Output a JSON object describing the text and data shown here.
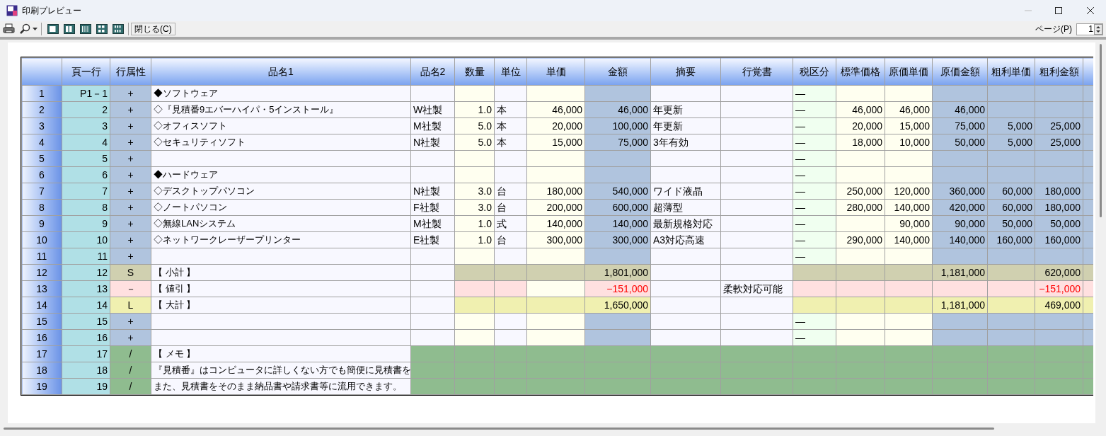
{
  "window": {
    "title": "印刷プレビュー"
  },
  "toolbar": {
    "close_button": "閉じる(C)",
    "page_label": "ページ(P)",
    "page_value": "1"
  },
  "table": {
    "columns": [
      {
        "label": "頁一行"
      },
      {
        "label": "行属性"
      },
      {
        "label": "品名1"
      },
      {
        "label": "品名2"
      },
      {
        "label": "数量"
      },
      {
        "label": "単位"
      },
      {
        "label": "単価"
      },
      {
        "label": "金額"
      },
      {
        "label": "摘要"
      },
      {
        "label": "行覚書"
      },
      {
        "label": "税区分"
      },
      {
        "label": "標準価格"
      },
      {
        "label": "原価単価"
      },
      {
        "label": "原価金額"
      },
      {
        "label": "粗利単価"
      },
      {
        "label": "粗利金額"
      }
    ],
    "rows": [
      {
        "kind": "item",
        "no": "1",
        "page_line": "P1－1",
        "attr": "+",
        "name1": "◆ソフトウェア",
        "tax": "—"
      },
      {
        "kind": "item",
        "no": "2",
        "page_line": "2",
        "attr": "+",
        "name1": "◇『見積番9エバーハイパ・5インストール』",
        "name2": "W社製",
        "qty": "1.0",
        "unit": "本",
        "price": "46,000",
        "amount": "46,000",
        "summary": "年更新",
        "tax": "—",
        "std_price": "46,000",
        "cost_unit": "46,000",
        "cost_amount": "46,000"
      },
      {
        "kind": "item",
        "no": "3",
        "page_line": "3",
        "attr": "+",
        "name1": "◇オフィスソフト",
        "name2": "M社製",
        "qty": "5.0",
        "unit": "本",
        "price": "20,000",
        "amount": "100,000",
        "summary": "年更新",
        "tax": "—",
        "std_price": "20,000",
        "cost_unit": "15,000",
        "cost_amount": "75,000",
        "gp_unit": "5,000",
        "gp_amount": "25,000"
      },
      {
        "kind": "item",
        "no": "4",
        "page_line": "4",
        "attr": "+",
        "name1": "◇セキュリティソフト",
        "name2": "N社製",
        "qty": "5.0",
        "unit": "本",
        "price": "15,000",
        "amount": "75,000",
        "summary": "3年有効",
        "tax": "—",
        "std_price": "18,000",
        "cost_unit": "10,000",
        "cost_amount": "50,000",
        "gp_unit": "5,000",
        "gp_amount": "25,000"
      },
      {
        "kind": "item",
        "no": "5",
        "page_line": "5",
        "attr": "+",
        "tax": "—"
      },
      {
        "kind": "item",
        "no": "6",
        "page_line": "6",
        "attr": "+",
        "name1": "◆ハードウェア",
        "tax": "—"
      },
      {
        "kind": "item",
        "no": "7",
        "page_line": "7",
        "attr": "+",
        "name1": "◇デスクトップパソコン",
        "name2": "N社製",
        "qty": "3.0",
        "unit": "台",
        "price": "180,000",
        "amount": "540,000",
        "summary": "ワイド液晶",
        "tax": "—",
        "std_price": "250,000",
        "cost_unit": "120,000",
        "cost_amount": "360,000",
        "gp_unit": "60,000",
        "gp_amount": "180,000"
      },
      {
        "kind": "item",
        "no": "8",
        "page_line": "8",
        "attr": "+",
        "name1": "◇ノートパソコン",
        "name2": "F社製",
        "qty": "3.0",
        "unit": "台",
        "price": "200,000",
        "amount": "600,000",
        "summary": "超薄型",
        "tax": "—",
        "std_price": "280,000",
        "cost_unit": "140,000",
        "cost_amount": "420,000",
        "gp_unit": "60,000",
        "gp_amount": "180,000"
      },
      {
        "kind": "item",
        "no": "9",
        "page_line": "9",
        "attr": "+",
        "name1": "◇無線LANシステム",
        "name2": "M社製",
        "qty": "1.0",
        "unit": "式",
        "price": "140,000",
        "amount": "140,000",
        "summary": "最新規格対応",
        "tax": "—",
        "cost_unit": "90,000",
        "cost_amount": "90,000",
        "gp_unit": "50,000",
        "gp_amount": "50,000"
      },
      {
        "kind": "item",
        "no": "10",
        "page_line": "10",
        "attr": "+",
        "name1": "◇ネットワークレーザープリンター",
        "name2": "E社製",
        "qty": "1.0",
        "unit": "台",
        "price": "300,000",
        "amount": "300,000",
        "summary": "A3対応高速",
        "tax": "—",
        "std_price": "290,000",
        "cost_unit": "140,000",
        "cost_amount": "140,000",
        "gp_unit": "160,000",
        "gp_amount": "160,000"
      },
      {
        "kind": "item",
        "no": "11",
        "page_line": "11",
        "attr": "+",
        "tax": "—"
      },
      {
        "kind": "subtotal",
        "no": "12",
        "page_line": "12",
        "attr": "S",
        "name1": "【 小計 】",
        "amount": "1,801,000",
        "cost_amount": "1,181,000",
        "gp_amount": "620,000"
      },
      {
        "kind": "discount",
        "no": "13",
        "page_line": "13",
        "attr": "－",
        "name1": "【 値引 】",
        "amount": "−151,000",
        "memo": "柔軟対応可能",
        "gp_amount": "−151,000"
      },
      {
        "kind": "total",
        "no": "14",
        "page_line": "14",
        "attr": "L",
        "name1": "【 大計 】",
        "amount": "1,650,000",
        "cost_amount": "1,181,000",
        "gp_amount": "469,000"
      },
      {
        "kind": "item",
        "no": "15",
        "page_line": "15",
        "attr": "+",
        "tax": "—"
      },
      {
        "kind": "item",
        "no": "16",
        "page_line": "16",
        "attr": "+",
        "tax": "—"
      },
      {
        "kind": "memo",
        "no": "17",
        "page_line": "17",
        "attr": "/",
        "name1": "【 メモ 】"
      },
      {
        "kind": "memo",
        "no": "18",
        "page_line": "18",
        "attr": "/",
        "name1": "『見積番』はコンピュータに詳しくない方でも簡便に見積書を"
      },
      {
        "kind": "memo",
        "no": "19",
        "page_line": "19",
        "attr": "/",
        "name1": "また、見積書をそのまま納品書や請求書等に流用できます。"
      }
    ]
  }
}
